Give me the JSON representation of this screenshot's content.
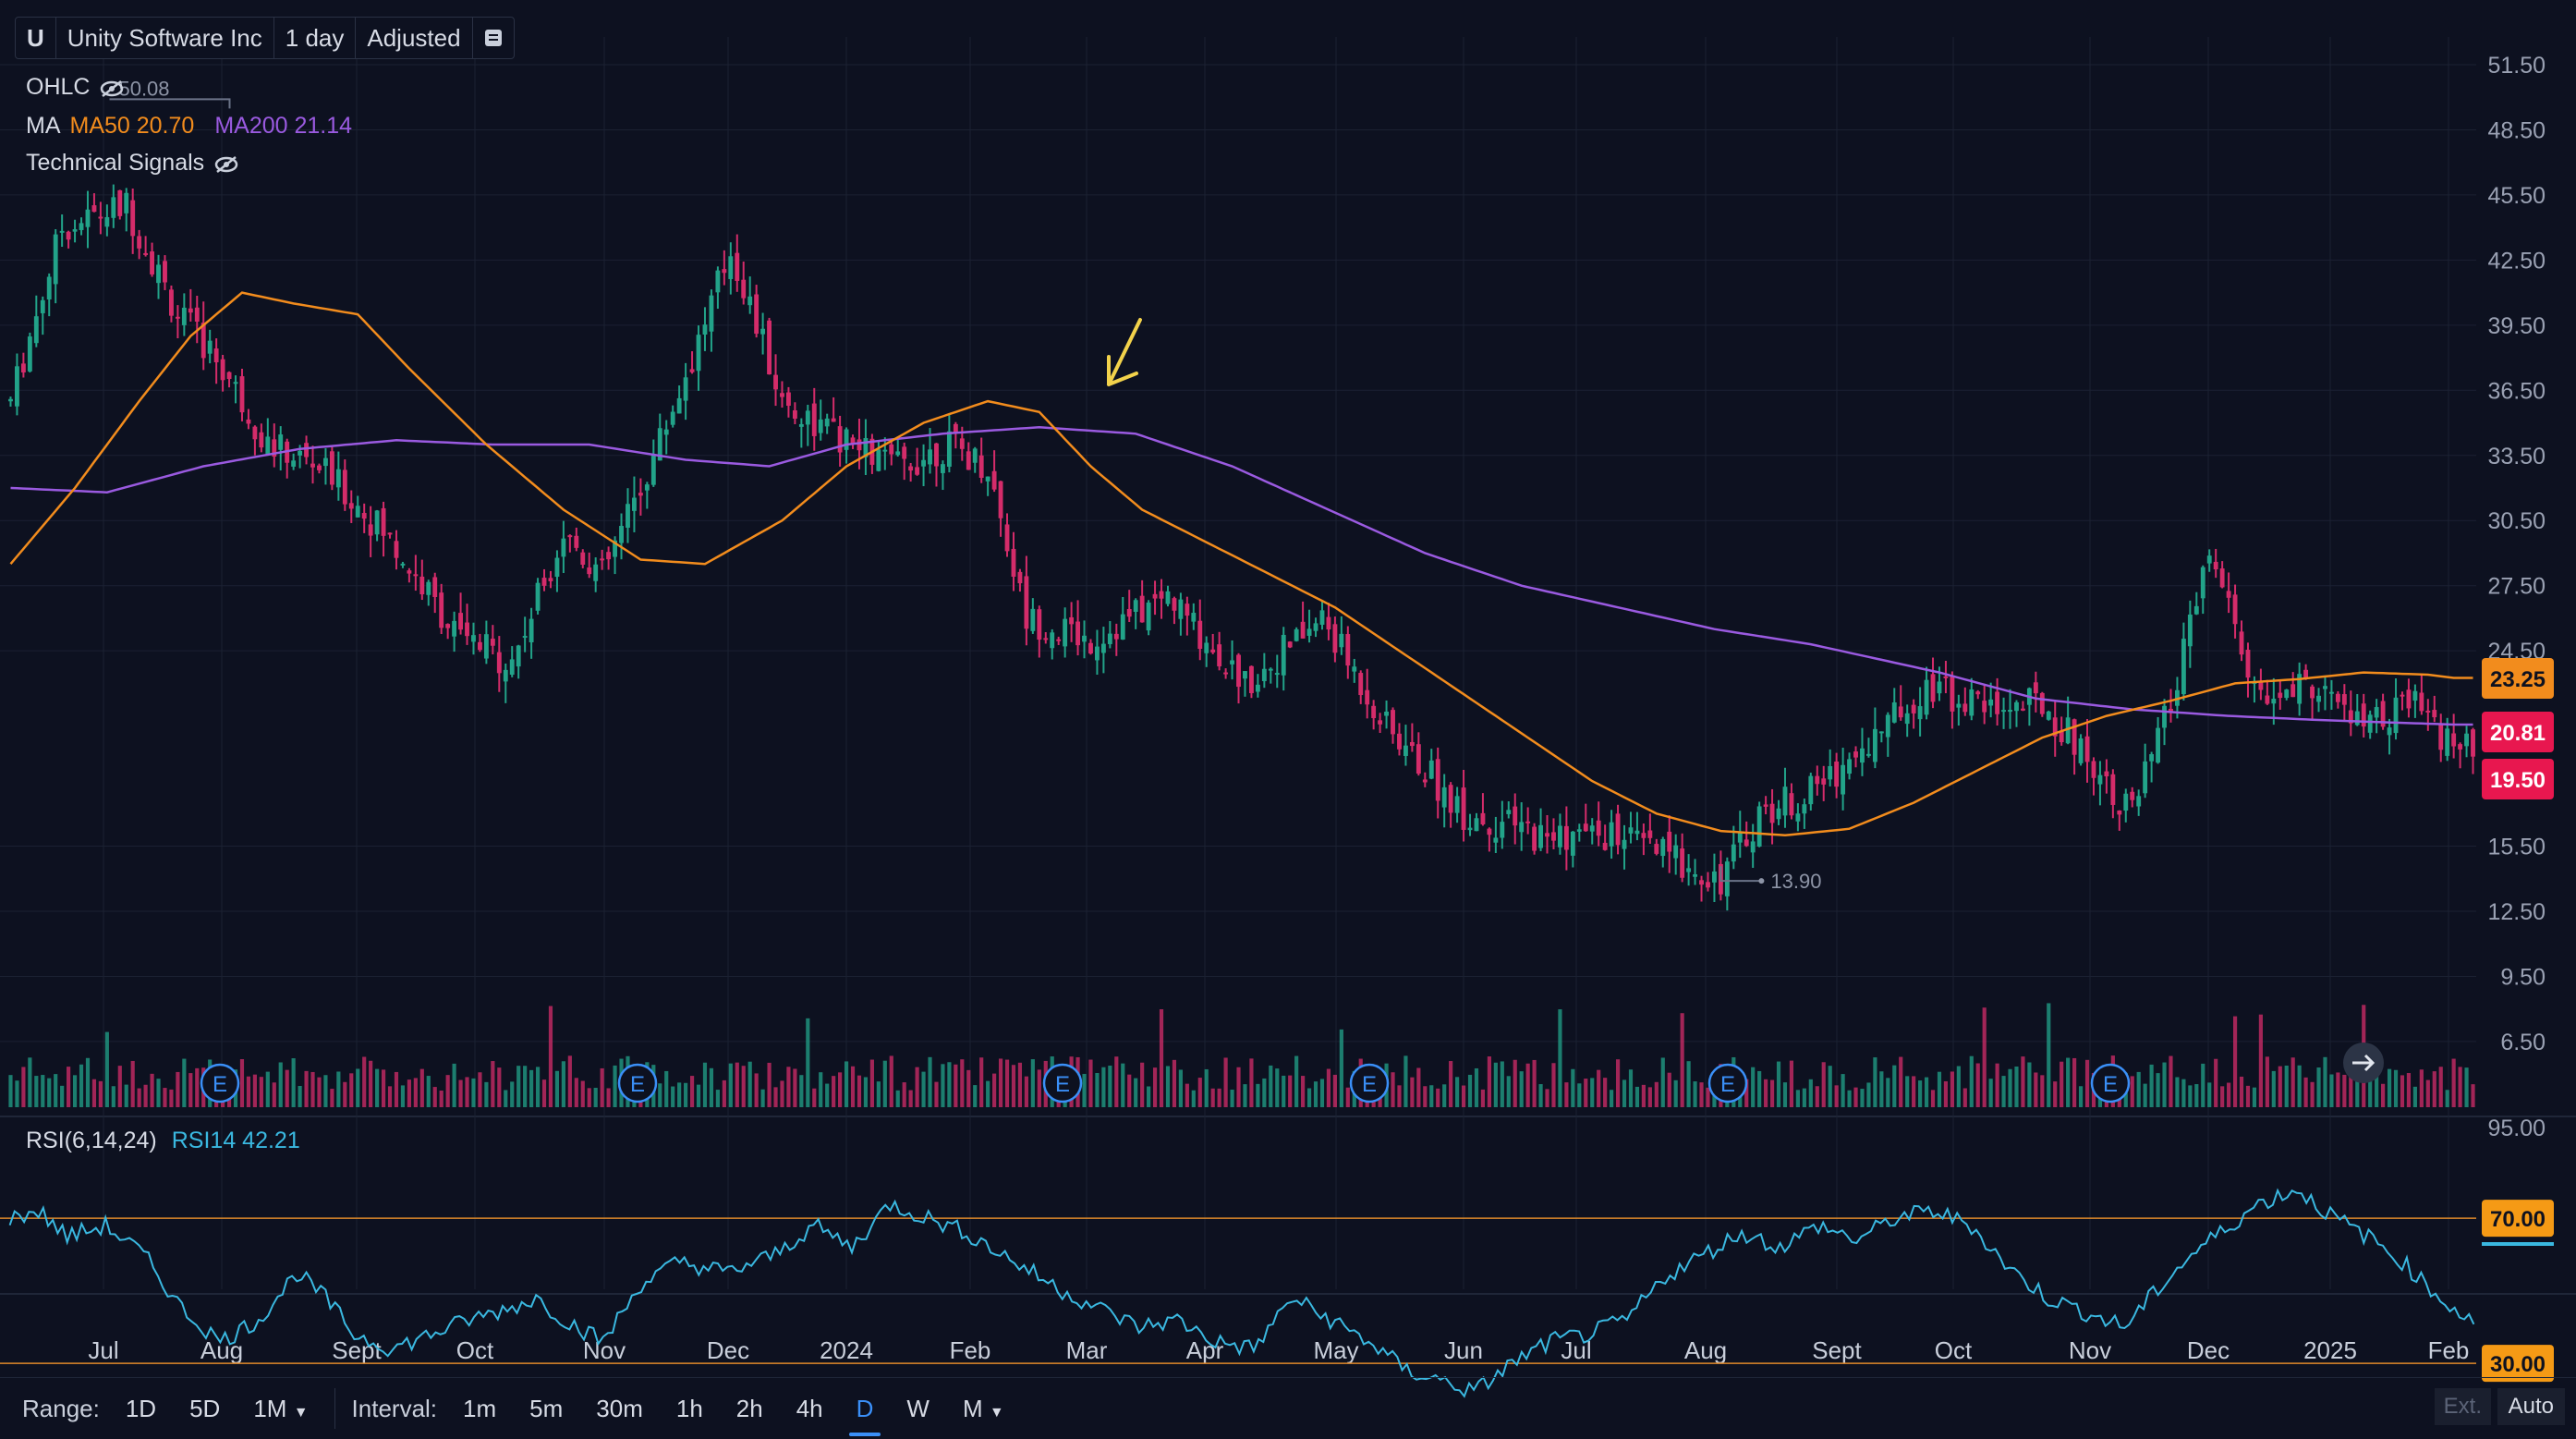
{
  "header": {
    "symbol": "U",
    "name": "Unity Software Inc",
    "interval": "1 day",
    "adjust": "Adjusted"
  },
  "legend": {
    "ohlc": "OHLC",
    "ma_label": "MA",
    "ma50": "MA50 20.70",
    "ma200": "MA200 21.14",
    "signals": "Technical Signals",
    "rsi_label": "RSI(6,14,24)",
    "rsi14": "RSI14 42.21"
  },
  "colors": {
    "bg": "#0d1120",
    "up": "#22a389",
    "down": "#d42c6a",
    "ma50": "#f28c1d",
    "ma200": "#9a5ae0",
    "rsi": "#3ab8e0",
    "band": "#e08a2a",
    "grid": "#1b2132"
  },
  "chart_data": {
    "type": "candlestick",
    "price_ticks": [
      "51.50",
      "48.50",
      "45.50",
      "42.50",
      "39.50",
      "36.50",
      "33.50",
      "30.50",
      "27.50",
      "24.50",
      "15.50",
      "12.50",
      "9.50",
      "6.50"
    ],
    "price_range": [
      10.5,
      53.0
    ],
    "price_badges": [
      {
        "value": "23.25",
        "color": "#f28c1d"
      },
      {
        "value": "20.81",
        "color": "#e8174f"
      },
      {
        "value": "19.50",
        "color": "#e8174f"
      }
    ],
    "high_label": "50.08",
    "low_label": "13.90",
    "months": [
      "Jul",
      "Aug",
      "Sept",
      "Oct",
      "Nov",
      "Dec",
      "2024",
      "Feb",
      "Mar",
      "Apr",
      "May",
      "Jun",
      "Jul",
      "Aug",
      "Sept",
      "Oct",
      "Nov",
      "Dec",
      "2025",
      "Feb"
    ],
    "earnings_marker": "E",
    "earnings_count": 6,
    "price_anchors": [
      [
        0,
        36
      ],
      [
        8,
        44
      ],
      [
        18,
        45
      ],
      [
        26,
        40
      ],
      [
        32,
        38
      ],
      [
        40,
        34
      ],
      [
        48,
        33
      ],
      [
        58,
        30
      ],
      [
        70,
        25
      ],
      [
        78,
        24
      ],
      [
        86,
        30
      ],
      [
        92,
        28
      ],
      [
        98,
        32
      ],
      [
        106,
        38
      ],
      [
        112,
        43
      ],
      [
        120,
        36
      ],
      [
        130,
        34
      ],
      [
        138,
        33
      ],
      [
        146,
        34
      ],
      [
        152,
        33
      ],
      [
        158,
        26
      ],
      [
        168,
        25
      ],
      [
        180,
        27
      ],
      [
        192,
        23
      ],
      [
        204,
        26
      ],
      [
        214,
        21
      ],
      [
        226,
        17
      ],
      [
        238,
        16
      ],
      [
        250,
        16
      ],
      [
        258,
        15
      ],
      [
        266,
        14
      ],
      [
        272,
        17
      ],
      [
        280,
        18
      ],
      [
        288,
        20
      ],
      [
        298,
        23
      ],
      [
        306,
        22
      ],
      [
        316,
        22
      ],
      [
        322,
        20
      ],
      [
        330,
        17
      ],
      [
        336,
        22
      ],
      [
        342,
        29
      ],
      [
        350,
        22
      ],
      [
        358,
        23
      ],
      [
        366,
        21
      ],
      [
        374,
        22
      ],
      [
        380,
        20
      ]
    ],
    "ma50_anchors": [
      [
        0,
        28.5
      ],
      [
        10,
        32
      ],
      [
        20,
        36
      ],
      [
        28,
        39
      ],
      [
        36,
        41
      ],
      [
        44,
        40.5
      ],
      [
        54,
        40
      ],
      [
        62,
        37.5
      ],
      [
        74,
        34
      ],
      [
        86,
        31
      ],
      [
        98,
        28.7
      ],
      [
        108,
        28.5
      ],
      [
        120,
        30.5
      ],
      [
        130,
        33
      ],
      [
        142,
        35
      ],
      [
        152,
        36
      ],
      [
        160,
        35.5
      ],
      [
        168,
        33
      ],
      [
        176,
        31
      ],
      [
        186,
        29.5
      ],
      [
        196,
        28
      ],
      [
        206,
        26.5
      ],
      [
        216,
        24.5
      ],
      [
        226,
        22.5
      ],
      [
        236,
        20.5
      ],
      [
        246,
        18.5
      ],
      [
        256,
        17
      ],
      [
        266,
        16.2
      ],
      [
        276,
        16
      ],
      [
        286,
        16.3
      ],
      [
        296,
        17.5
      ],
      [
        306,
        19
      ],
      [
        316,
        20.5
      ],
      [
        326,
        21.5
      ],
      [
        336,
        22.2
      ],
      [
        346,
        23
      ],
      [
        356,
        23.2
      ],
      [
        366,
        23.5
      ],
      [
        376,
        23.4
      ],
      [
        380,
        23.25
      ]
    ],
    "ma200_anchors": [
      [
        0,
        32
      ],
      [
        15,
        31.8
      ],
      [
        30,
        33
      ],
      [
        45,
        33.8
      ],
      [
        60,
        34.2
      ],
      [
        75,
        34
      ],
      [
        90,
        34
      ],
      [
        105,
        33.3
      ],
      [
        118,
        33
      ],
      [
        130,
        34
      ],
      [
        145,
        34.5
      ],
      [
        160,
        34.8
      ],
      [
        175,
        34.5
      ],
      [
        190,
        33
      ],
      [
        205,
        31
      ],
      [
        220,
        29
      ],
      [
        235,
        27.5
      ],
      [
        250,
        26.5
      ],
      [
        265,
        25.5
      ],
      [
        280,
        24.8
      ],
      [
        300,
        23.5
      ],
      [
        315,
        22.3
      ],
      [
        330,
        21.8
      ],
      [
        345,
        21.5
      ],
      [
        360,
        21.3
      ],
      [
        380,
        21.1
      ]
    ],
    "rsi_ticks": [
      "95.00"
    ],
    "rsi_badges": [
      {
        "value": "70.00",
        "color": "#f59a15"
      },
      {
        "value": "30.00",
        "color": "#f59a15"
      }
    ],
    "rsi_range": [
      10,
      95
    ],
    "rsi_levels": [
      70,
      30
    ],
    "rsi_anchors": [
      [
        0,
        70
      ],
      [
        6,
        72
      ],
      [
        12,
        65
      ],
      [
        20,
        68
      ],
      [
        28,
        60
      ],
      [
        36,
        45
      ],
      [
        44,
        36
      ],
      [
        52,
        42
      ],
      [
        60,
        55
      ],
      [
        66,
        48
      ],
      [
        72,
        38
      ],
      [
        80,
        34
      ],
      [
        88,
        38
      ],
      [
        96,
        42
      ],
      [
        104,
        45
      ],
      [
        110,
        48
      ],
      [
        116,
        42
      ],
      [
        124,
        36
      ],
      [
        132,
        52
      ],
      [
        140,
        58
      ],
      [
        150,
        55
      ],
      [
        160,
        60
      ],
      [
        168,
        68
      ],
      [
        176,
        62
      ],
      [
        184,
        74
      ],
      [
        192,
        70
      ],
      [
        200,
        66
      ],
      [
        210,
        58
      ],
      [
        220,
        50
      ],
      [
        228,
        45
      ],
      [
        236,
        40
      ],
      [
        244,
        42
      ],
      [
        252,
        36
      ],
      [
        260,
        34
      ],
      [
        268,
        48
      ],
      [
        276,
        42
      ],
      [
        284,
        36
      ],
      [
        292,
        28
      ],
      [
        300,
        25
      ],
      [
        306,
        22
      ],
      [
        314,
        30
      ],
      [
        322,
        36
      ],
      [
        330,
        38
      ],
      [
        338,
        42
      ],
      [
        346,
        54
      ],
      [
        354,
        60
      ],
      [
        362,
        66
      ],
      [
        370,
        62
      ],
      [
        378,
        68
      ],
      [
        386,
        64
      ],
      [
        394,
        70
      ],
      [
        402,
        72
      ],
      [
        410,
        68
      ],
      [
        418,
        56
      ],
      [
        426,
        48
      ],
      [
        434,
        44
      ],
      [
        442,
        40
      ],
      [
        450,
        52
      ],
      [
        456,
        60
      ],
      [
        462,
        66
      ],
      [
        470,
        74
      ],
      [
        478,
        78
      ],
      [
        486,
        70
      ],
      [
        494,
        64
      ],
      [
        500,
        58
      ],
      [
        508,
        48
      ],
      [
        514,
        42
      ]
    ]
  },
  "footer": {
    "range_label": "Range:",
    "ranges": [
      "1D",
      "5D",
      "1M"
    ],
    "interval_label": "Interval:",
    "intervals": [
      "1m",
      "5m",
      "30m",
      "1h",
      "2h",
      "4h",
      "D",
      "W",
      "M"
    ],
    "ext": "Ext.",
    "auto": "Auto"
  }
}
